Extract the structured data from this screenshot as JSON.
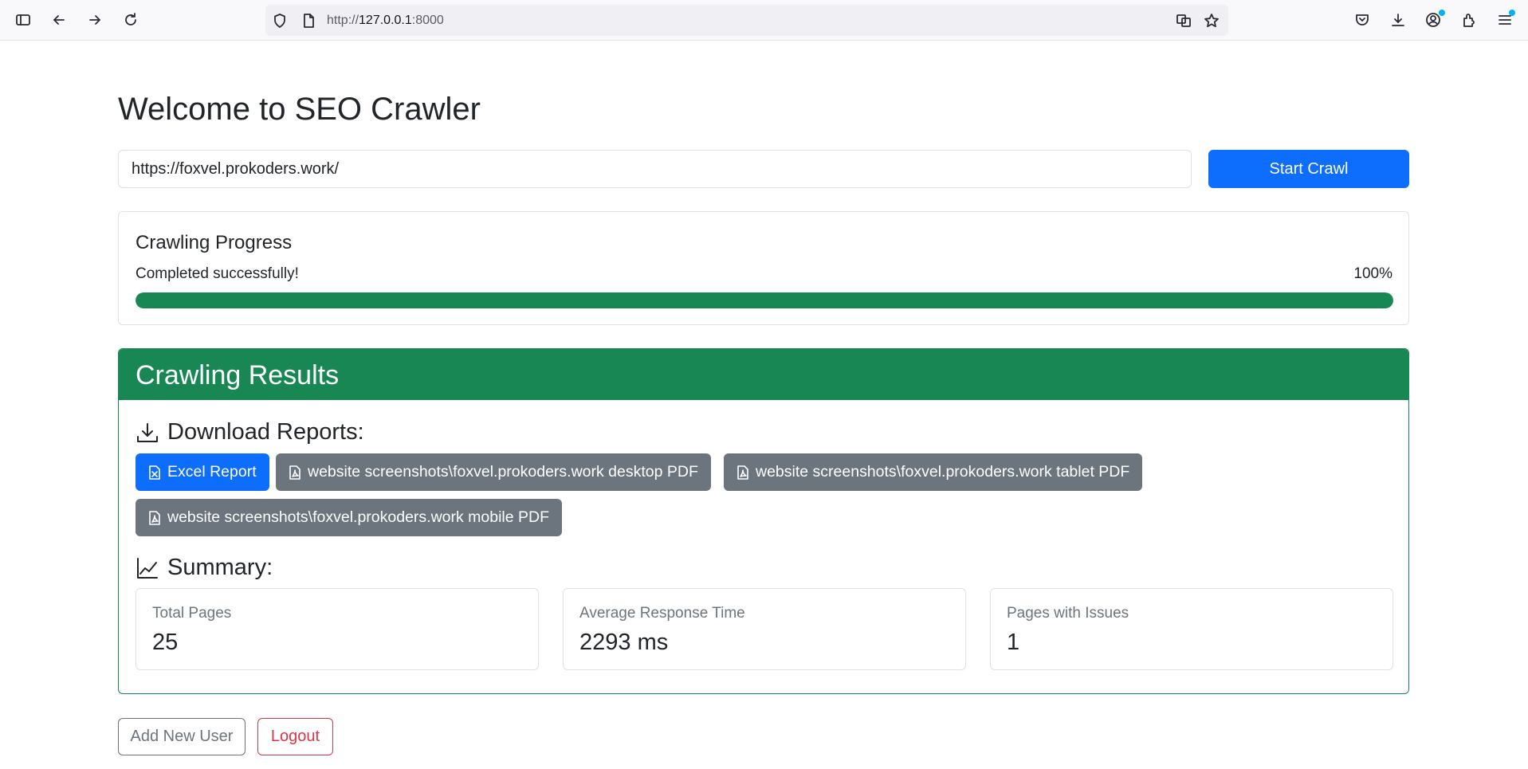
{
  "browser": {
    "url_scheme": "http://",
    "url_host": "127.0.0.1",
    "url_port": ":8000"
  },
  "page": {
    "title": "Welcome to SEO Crawler",
    "url_input_value": "https://foxvel.prokoders.work/",
    "start_button": "Start Crawl"
  },
  "progress": {
    "title": "Crawling Progress",
    "status": "Completed successfully!",
    "percent_label": "100%",
    "percent": 100,
    "color": "#198754"
  },
  "results": {
    "title": "Crawling Results",
    "header_color": "#198754",
    "downloads_heading": "Download Reports:",
    "reports": [
      {
        "label": "Excel Report",
        "icon": "file-excel-icon"
      },
      {
        "label": "website screenshots\\foxvel.prokoders.work desktop PDF",
        "icon": "file-pdf-icon"
      },
      {
        "label": "website screenshots\\foxvel.prokoders.work tablet PDF",
        "icon": "file-pdf-icon"
      },
      {
        "label": "website screenshots\\foxvel.prokoders.work mobile PDF",
        "icon": "file-pdf-icon"
      }
    ],
    "summary_heading": "Summary:",
    "stats": [
      {
        "label": "Total Pages",
        "value": "25"
      },
      {
        "label": "Average Response Time",
        "value": "2293 ms"
      },
      {
        "label": "Pages with Issues",
        "value": "1"
      }
    ]
  },
  "footer": {
    "add_user": "Add New User",
    "logout": "Logout"
  },
  "colors": {
    "primary": "#0d6efd",
    "secondary": "#6c757d",
    "success": "#198754",
    "danger": "#dc3545"
  }
}
